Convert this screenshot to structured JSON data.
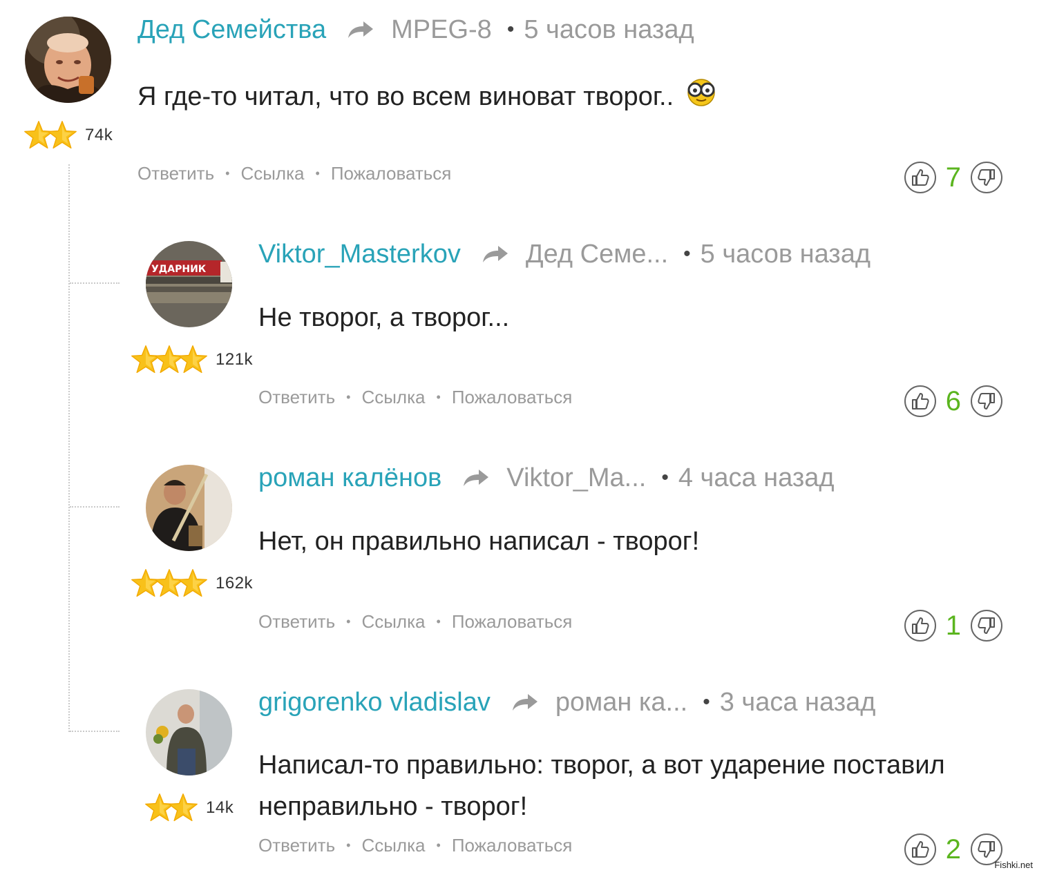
{
  "comments": [
    {
      "author": "Дед Семейства",
      "reply_to": "MPEG-8",
      "time": "5 часов назад",
      "text": "Я где-то читал, что во всем виноват творог..",
      "rating": "74k",
      "stars": 2,
      "score": "7",
      "actions": {
        "reply": "Ответить",
        "link": "Ссылка",
        "report": "Пожаловаться"
      }
    },
    {
      "author": "Viktor_Masterkov",
      "reply_to": "Дед Семе...",
      "time": "5 часов назад",
      "text": "Не творог, а творог...",
      "rating": "121k",
      "stars": 3,
      "score": "6",
      "avatar_sign": "УДАРНИК",
      "actions": {
        "reply": "Ответить",
        "link": "Ссылка",
        "report": "Пожаловаться"
      }
    },
    {
      "author": "роман калёнов",
      "reply_to": "Viktor_Ma...",
      "time": "4 часа назад",
      "text": "Нет, он правильно написал - творог!",
      "rating": "162k",
      "stars": 3,
      "score": "1",
      "actions": {
        "reply": "Ответить",
        "link": "Ссылка",
        "report": "Пожаловаться"
      }
    },
    {
      "author": "grigorenko vladislav",
      "reply_to": "роман ка...",
      "time": "3 часа назад",
      "text_line1": "Написал-то правильно: творог, а вот ударение поставил",
      "text_line2": "неправильно - творог!",
      "rating": "14k",
      "stars": 2,
      "score": "2",
      "actions": {
        "reply": "Ответить",
        "link": "Ссылка",
        "report": "Пожаловаться"
      }
    }
  ],
  "watermark": "Fishki.net",
  "colors": {
    "author": "#29a3b8",
    "score": "#5bb51f",
    "meta": "#9a9a9a",
    "star": "#f7b500"
  }
}
